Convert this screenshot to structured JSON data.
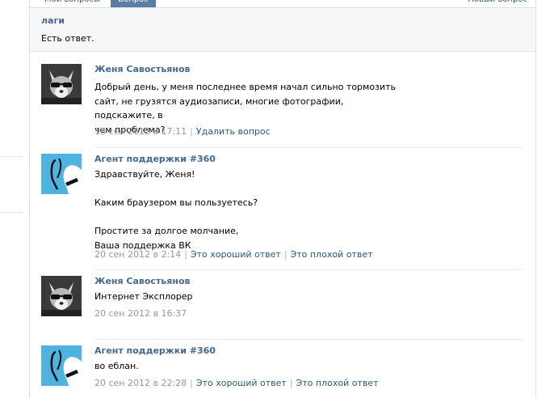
{
  "tabs": {
    "my_questions": "Мои вопросы",
    "question": "Вопрос",
    "new_question": "Новый вопрос"
  },
  "question": {
    "title": "лаги",
    "status": "Есть ответ."
  },
  "messages": [
    {
      "author": "Женя Савостьянов",
      "avatar": "fox-avatar",
      "text": "Добрый день, у меня последнее время начал сильно тормозить\nсайт, не грузятся аудиозаписи, многие фотографии, подскажите, в\nчем проблема?",
      "date": "18 сен 2012 в 17:11",
      "actions": [
        "Удалить вопрос"
      ]
    },
    {
      "author": "Агент поддержки #360",
      "avatar": "agent-avatar",
      "text": "Здравствуйте, Женя!\n\nКаким браузером вы пользуетесь?\n\nПростите за долгое молчание,\nВаша поддержка ВК",
      "date": "20 сен 2012 в 2:14",
      "actions": [
        "Это хороший ответ",
        "Это плохой ответ"
      ]
    },
    {
      "author": "Женя Савостьянов",
      "avatar": "fox-avatar",
      "text": "Интернет Эксплорер",
      "date": "20 сен 2012 в 16:37",
      "actions": []
    },
    {
      "author": "Агент поддержки #360",
      "avatar": "agent-avatar",
      "text": "во еблан.",
      "date": "20 сен 2012 в 22:28",
      "actions": [
        "Это хороший ответ",
        "Это плохой ответ"
      ]
    }
  ]
}
